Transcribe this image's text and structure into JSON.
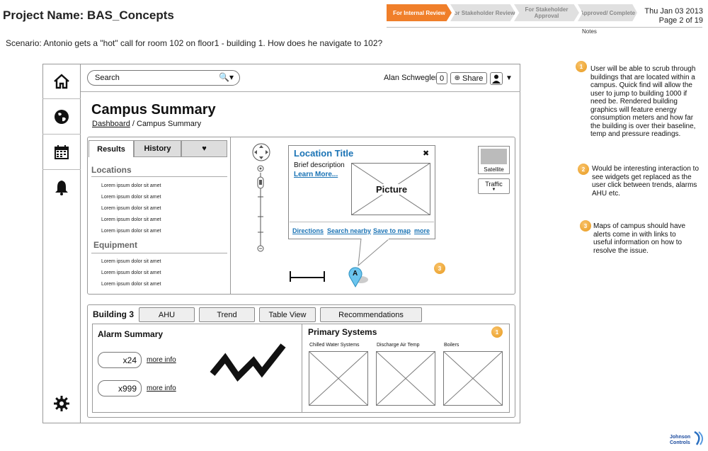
{
  "header": {
    "project": "Project Name: BAS_Concepts",
    "steps": [
      {
        "label": "For Internal Review"
      },
      {
        "label": "For Stakeholder Review"
      },
      {
        "label": "For Stakeholder Approval"
      },
      {
        "label": "Approved/ Complete"
      }
    ],
    "date": "Thu Jan 03 2013",
    "page": "Page 2 of 19",
    "notes_label": "Notes"
  },
  "scenario": "Scenario: Antonio gets a \"hot\" call for room 102 on floor1 - building 1. How does he navigate to 102?",
  "sidebar": {
    "icons": [
      "home-icon",
      "globe-icon",
      "calendar-icon",
      "bell-icon",
      "gear-icon"
    ]
  },
  "topbar": {
    "search_placeholder": "Search",
    "user_name": "Alan Schwegler",
    "notif_count": "0",
    "share_label": "Share"
  },
  "page": {
    "title": "Campus Summary",
    "breadcrumb_link": "Dashboard",
    "breadcrumb_rest": " / Campus Summary"
  },
  "tabs": {
    "results": "Results",
    "history": "History"
  },
  "locations": {
    "heading": "Locations",
    "items": [
      "Lorem ipsum dolor sit amet",
      "Lorem ipsum dolor sit amet",
      "Lorem ipsum dolor sit amet",
      "Lorem ipsum dolor sit amet",
      "Lorem ipsum dolor sit amet"
    ]
  },
  "equipment": {
    "heading": "Equipment",
    "items": [
      "Lorem ipsum dolor sit amet",
      "Lorem ipsum dolor sit amet",
      "Lorem ipsum dolor sit amet"
    ]
  },
  "map": {
    "popup_title": "Location Title",
    "popup_desc": "Brief description",
    "popup_learn": "Learn More...",
    "picture": "Picture",
    "links": [
      "Directions",
      "Search nearby",
      "Save to map",
      "more"
    ],
    "marker": "A",
    "satellite": "Satellite",
    "traffic": "Traffic",
    "badge": "3"
  },
  "building": {
    "name": "Building 3",
    "tabs": [
      "AHU",
      "Trend",
      "Table View",
      "Recommendations"
    ],
    "alarm_heading": "Alarm Summary",
    "alarms": [
      {
        "count": "x24",
        "link": "more info"
      },
      {
        "count": "x999",
        "link": "more info"
      }
    ],
    "primary_heading": "Primary Systems",
    "primary_badge": "1",
    "systems": [
      "Chilled Water Systems",
      "Discharge Air Temp",
      "Boilers"
    ]
  },
  "notes": [
    {
      "num": "1",
      "text": "User will be able to scrub through buildings that are located within a campus. Quick find will allow the user to jump to building 1000 if need be. Rendered building graphics will feature energy consumption meters and how far the building is over their baseline, temp and pressure readings."
    },
    {
      "num": "2",
      "text": "Would be interesting interaction to see widgets get replaced as the user click between trends, alarms AHU etc."
    },
    {
      "num": "3",
      "text": "Maps of campus should have alerts come in with links to useful information on how to resolve the issue."
    }
  ],
  "footer": {
    "brand_line1": "Johnson",
    "brand_line2": "Controls"
  }
}
